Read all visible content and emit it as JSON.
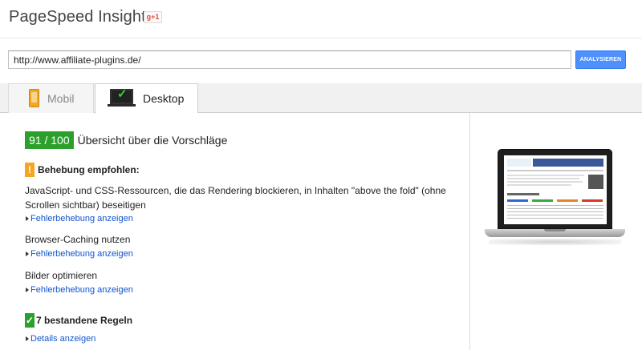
{
  "header": {
    "title": "PageSpeed Insights",
    "gplus_label": "g+1"
  },
  "search": {
    "url_value": "http://www.affiliate-plugins.de/",
    "button_label": "ANALYSIEREN"
  },
  "tabs": [
    {
      "label": "Mobil",
      "icon": "phone-icon",
      "active": false
    },
    {
      "label": "Desktop",
      "icon": "monitor-check-icon",
      "active": true
    }
  ],
  "summary": {
    "score": "91 / 100",
    "title": "Übersicht über die Vorschläge"
  },
  "warning_section": {
    "title": "Behebung empfohlen:",
    "icon": "exclamation-icon",
    "rules": [
      {
        "text": "JavaScript- und CSS-Ressourcen, die das Rendering blockieren, in Inhalten \"above the fold\" (ohne Scrollen sichtbar) beseitigen",
        "link": "Fehlerbehebung anzeigen"
      },
      {
        "text": "Browser-Caching nutzen",
        "link": "Fehlerbehebung anzeigen"
      },
      {
        "text": "Bilder optimieren",
        "link": "Fehlerbehebung anzeigen"
      }
    ]
  },
  "passed_section": {
    "title": "7 bestandene Regeln",
    "icon": "checkmark-icon",
    "link": "Details anzeigen"
  },
  "colors": {
    "score_green": "#2ca02c",
    "warning_orange": "#f5a623",
    "link_blue": "#1155cc",
    "button_blue": "#4d90fe"
  }
}
